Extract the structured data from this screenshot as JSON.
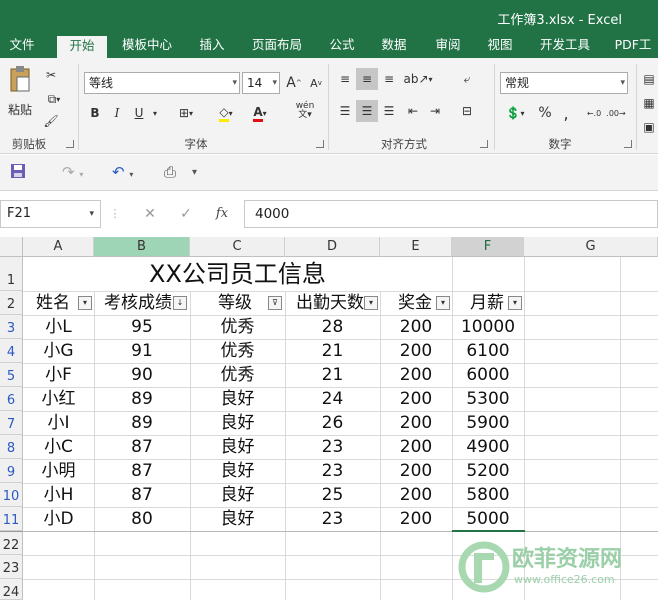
{
  "window": {
    "title": "工作簿3.xlsx - Excel"
  },
  "tabs": [
    "文件",
    "开始",
    "模板中心",
    "插入",
    "页面布局",
    "公式",
    "数据",
    "审阅",
    "视图",
    "开发工具",
    "PDF工"
  ],
  "ribbon": {
    "clipboard": {
      "paste": "粘贴",
      "label": "剪贴板"
    },
    "font": {
      "name": "等线",
      "size": "14",
      "label": "字体",
      "bold": "B",
      "italic": "I",
      "underline": "U",
      "grow": "A",
      "shrink": "A",
      "wen": "wén"
    },
    "alignment": {
      "label": "对齐方式"
    },
    "number": {
      "format": "常规",
      "label": "数字",
      "percent": "%",
      "comma": ","
    }
  },
  "formula_bar": {
    "name_box": "F21",
    "fx": "fx",
    "value": "4000"
  },
  "sheet": {
    "columns": [
      "A",
      "B",
      "C",
      "D",
      "E",
      "F",
      "G"
    ],
    "row_numbers": [
      "1",
      "2",
      "3",
      "4",
      "5",
      "6",
      "7",
      "8",
      "9",
      "10",
      "11",
      "22",
      "23",
      "24"
    ],
    "title": "XX公司员工信息",
    "headers": [
      "姓名",
      "考核成绩",
      "等级",
      "出勤天数",
      "奖金",
      "月薪"
    ],
    "rows": [
      [
        "小L",
        "95",
        "优秀",
        "28",
        "200",
        "10000"
      ],
      [
        "小G",
        "91",
        "优秀",
        "21",
        "200",
        "6100"
      ],
      [
        "小F",
        "90",
        "优秀",
        "21",
        "200",
        "6000"
      ],
      [
        "小红",
        "89",
        "良好",
        "24",
        "200",
        "5300"
      ],
      [
        "小I",
        "89",
        "良好",
        "26",
        "200",
        "5900"
      ],
      [
        "小C",
        "87",
        "良好",
        "23",
        "200",
        "4900"
      ],
      [
        "小明",
        "87",
        "良好",
        "23",
        "200",
        "5200"
      ],
      [
        "小H",
        "87",
        "良好",
        "25",
        "200",
        "5800"
      ],
      [
        "小D",
        "80",
        "良好",
        "23",
        "200",
        "5000"
      ]
    ]
  },
  "watermark": {
    "text": "欧菲资源网",
    "url": "www.office26.com"
  },
  "colors": {
    "excel_green": "#217346",
    "row_link_blue": "#2b59c3",
    "selected_col": "#9fd5b7"
  }
}
